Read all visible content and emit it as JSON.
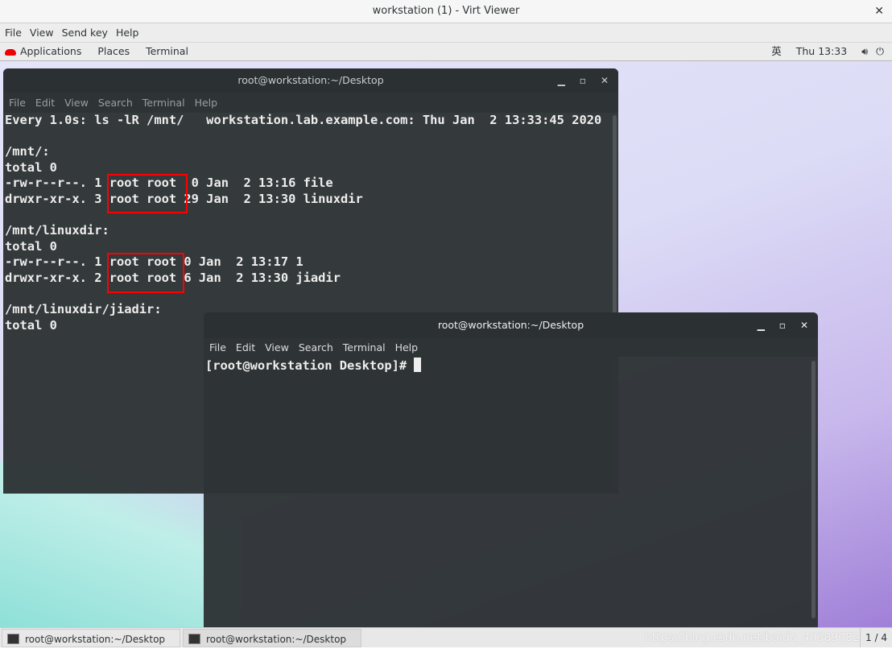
{
  "window": {
    "title": "workstation (1) - Virt Viewer",
    "menu": [
      "File",
      "View",
      "Send key",
      "Help"
    ]
  },
  "gnome_bar": {
    "menus": [
      "Applications",
      "Places",
      "Terminal"
    ],
    "input_method": "英",
    "clock": "Thu 13:33"
  },
  "terminal1": {
    "title": "root@workstation:~/Desktop",
    "menu": [
      "File",
      "Edit",
      "View",
      "Search",
      "Terminal",
      "Help"
    ],
    "lines": [
      "Every 1.0s: ls -lR /mnt/   workstation.lab.example.com: Thu Jan  2 13:33:45 2020",
      "",
      "/mnt/:",
      "total 0",
      "-rw-r--r--. 1 root root  0 Jan  2 13:16 file",
      "drwxr-xr-x. 3 root root 29 Jan  2 13:30 linuxdir",
      "",
      "/mnt/linuxdir:",
      "total 0",
      "-rw-r--r--. 1 root root 0 Jan  2 13:17 1",
      "drwxr-xr-x. 2 root root 6 Jan  2 13:30 jiadir",
      "",
      "/mnt/linuxdir/jiadir:",
      "total 0"
    ]
  },
  "terminal2": {
    "title": "root@workstation:~/Desktop",
    "menu": [
      "File",
      "Edit",
      "View",
      "Search",
      "Terminal",
      "Help"
    ],
    "prompt": "[root@workstation Desktop]# "
  },
  "taskbar": {
    "tasks": [
      "root@workstation:~/Desktop",
      "root@workstation:~/Desktop"
    ],
    "watermark": "https://blog.csdn.net/baidu_40389082",
    "page": "1 / 4"
  },
  "annotation_color": "#ff0000"
}
